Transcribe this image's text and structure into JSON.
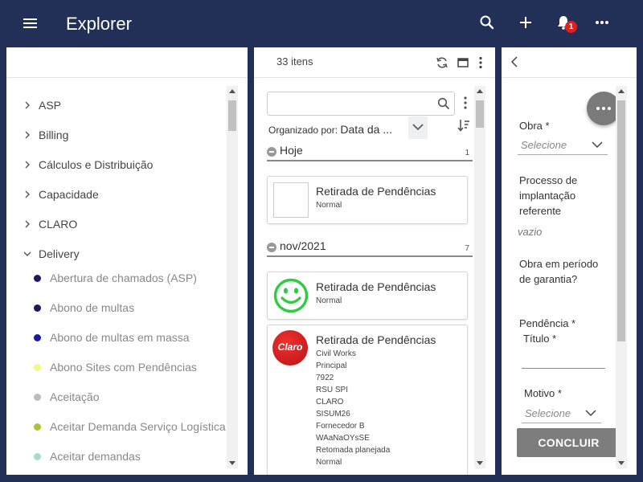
{
  "header": {
    "title": "Explorer",
    "notification_count": "1"
  },
  "tree": {
    "items": [
      {
        "label": "ASP",
        "expanded": false
      },
      {
        "label": "Billing",
        "expanded": false
      },
      {
        "label": "Cálculos e Distribuição",
        "expanded": false
      },
      {
        "label": "Capacidade",
        "expanded": false
      },
      {
        "label": "CLARO",
        "expanded": false
      },
      {
        "label": "Delivery",
        "expanded": true
      }
    ],
    "sub_items": [
      {
        "label": "Abertura de chamados (ASP)",
        "color": "#1a1a5c"
      },
      {
        "label": "Abono de multas",
        "color": "#1a1a5c"
      },
      {
        "label": "Abono de multas em massa",
        "color": "#1a1aa0"
      },
      {
        "label": "Abono Sites com Pendências",
        "color": "#f5f58a"
      },
      {
        "label": "Aceitação",
        "color": "#bdbdbd"
      },
      {
        "label": "Aceitar Demanda Serviço Logística",
        "color": "#a8c43c"
      },
      {
        "label": "Aceitar demandas",
        "color": "#a8dcc8"
      }
    ]
  },
  "list": {
    "count_label": "33 itens",
    "search_placeholder": "",
    "sort_prefix": "Organizado por:",
    "sort_value": "Data da ...",
    "groups": [
      {
        "title": "Hoje",
        "count": "1"
      },
      {
        "title": "nov/2021",
        "count": "7"
      }
    ],
    "cards": [
      {
        "title": "Retirada de Pendências",
        "lines": [
          "Normal"
        ]
      },
      {
        "title": "Retirada de Pendências",
        "lines": [
          "Normal"
        ]
      },
      {
        "title": "Retirada de Pendências",
        "logo_text": "Claro",
        "lines": [
          "Civil Works",
          "Principal",
          "7922",
          "RSU SPI",
          "CLARO",
          "SISUM26",
          "Fornecedor B",
          "WAaNaOYsSE",
          "Retomada planejada",
          "Normal"
        ]
      }
    ]
  },
  "form": {
    "obra_label": "Obra *",
    "obra_placeholder": "Selecione",
    "processo_label": [
      "Processo de",
      "implantação",
      "referente"
    ],
    "processo_value": "vazio",
    "garantia_label": [
      "Obra em período",
      "de garantia?"
    ],
    "pendencia_label": "Pendência *",
    "titulo_label": "Título *",
    "motivo_label": "Motivo *",
    "motivo_placeholder": "Selecione",
    "submit_label": "CONCLUIR"
  },
  "colors": {
    "header_bg": "#223058",
    "button_gray": "#7d7d7d",
    "smiley_green": "#2ecc40",
    "claro_red": "#d91c1c"
  }
}
